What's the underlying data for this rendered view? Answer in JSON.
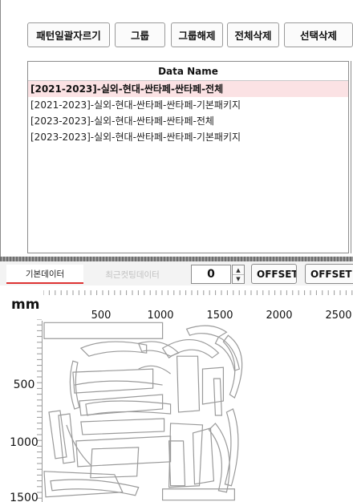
{
  "toolbar": {
    "buttons": [
      "패턴일괄자르기",
      "그룹",
      "그룹해제",
      "전체삭제",
      "선택삭제"
    ]
  },
  "list": {
    "header": "Data Name",
    "items": [
      "[2021-2023]-실외-현대-싼타페-싼타페-전체",
      "[2021-2023]-실외-현대-싼타페-싼타페-기본패키지",
      "[2023-2023]-실외-현대-싼타페-싼타페-전체",
      "[2023-2023]-실외-현대-싼타페-싼타페-기본패키지"
    ],
    "selected_index": 0
  },
  "bottom_bar": {
    "tabs": [
      "기본데이터",
      "최근컷팅데이터"
    ],
    "active_tab": 0,
    "offset_value": "0",
    "offset_label": "OFFSET",
    "offset_po_label": "OFFSET PO"
  },
  "canvas": {
    "unit": "mm",
    "x_ticks": [
      "500",
      "1000",
      "1500",
      "2000",
      "2500"
    ],
    "y_ticks": [
      "500",
      "1000",
      "1500"
    ]
  },
  "colors": {
    "selected_row": "#fbe2e4",
    "active_tab_underline": "#dd3333",
    "pattern_stroke": "#9a9a9a"
  }
}
